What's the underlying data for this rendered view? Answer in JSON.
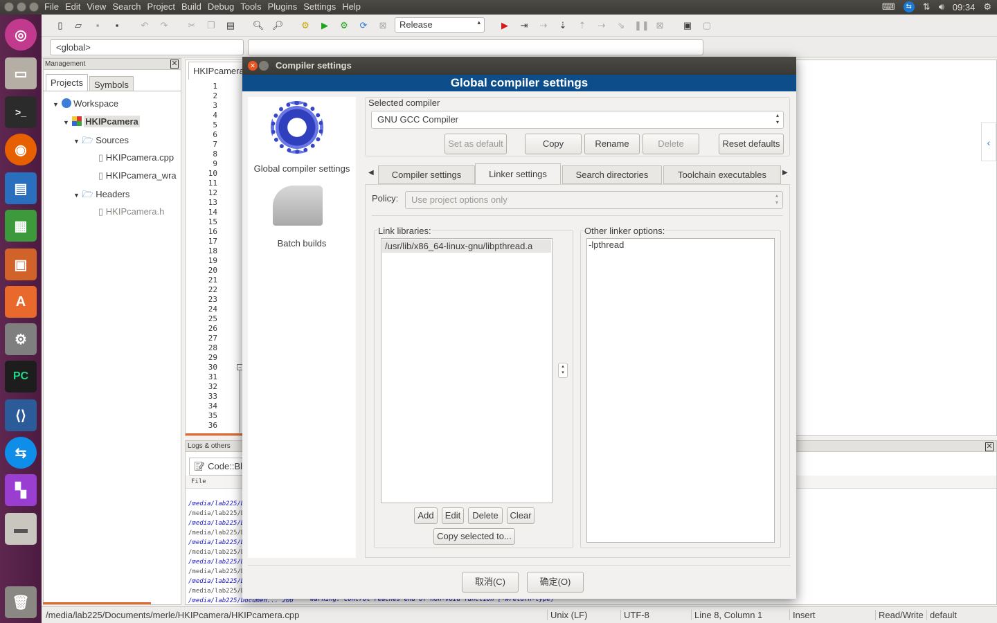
{
  "topbar": {
    "menus": [
      "File",
      "Edit",
      "View",
      "Search",
      "Project",
      "Build",
      "Debug",
      "Tools",
      "Plugins",
      "Settings",
      "Help"
    ],
    "clock": "09:34"
  },
  "toolbar": {
    "build_target": "Release",
    "scope": "<global>"
  },
  "management": {
    "title": "Management",
    "tabs": [
      "Projects",
      "Symbols"
    ],
    "tree": {
      "workspace": "Workspace",
      "project": "HKIPcamera",
      "sources": "Sources",
      "source_files": [
        "HKIPcamera.cpp",
        "HKIPcamera_wra"
      ],
      "headers": "Headers",
      "header_files": [
        "HKIPcamera.h"
      ]
    }
  },
  "editor": {
    "tab": "HKIPcamera",
    "line_numbers": [
      "1",
      "2",
      "3",
      "4",
      "5",
      "6",
      "7",
      "8",
      "9",
      "10",
      "11",
      "12",
      "13",
      "14",
      "15",
      "16",
      "17",
      "18",
      "19",
      "20",
      "21",
      "22",
      "23",
      "24",
      "25",
      "26",
      "27",
      "28",
      "29",
      "30",
      "31",
      "32",
      "33",
      "34",
      "35",
      "36"
    ]
  },
  "logs": {
    "title": "Logs & others",
    "tab": "Code::Bl",
    "column": "File",
    "rows": [
      "/media/lab225/Dc",
      "/media/lab225/Dc",
      "/media/lab225/Dc",
      "/media/lab225/Dc",
      "/media/lab225/Dc",
      "/media/lab225/Dc",
      "/media/lab225/Dc",
      "/media/lab225/Dc",
      "/media/lab225/Dc",
      "/media/lab225/Dc",
      "/media/lab225/Documen...  200"
    ],
    "last_message": "warning: control reaches end of non-void function [-Wreturn-type]"
  },
  "statusbar": {
    "path": "/media/lab225/Documents/merle/HKIPcamera/HKIPcamera.cpp",
    "eol": "Unix (LF)",
    "encoding": "UTF-8",
    "position": "Line 8, Column 1",
    "mode": "Insert",
    "access": "Read/Write",
    "lang": "default"
  },
  "dialog": {
    "title": "Compiler settings",
    "header": "Global compiler settings",
    "left_items": [
      "Global compiler settings",
      "Batch builds"
    ],
    "selected_compiler_label": "Selected compiler",
    "selected_compiler": "GNU GCC Compiler",
    "buttons": {
      "set_default": "Set as default",
      "copy": "Copy",
      "rename": "Rename",
      "delete": "Delete",
      "reset": "Reset defaults"
    },
    "tabs": [
      "Compiler settings",
      "Linker settings",
      "Search directories",
      "Toolchain executables"
    ],
    "active_tab": "Linker settings",
    "policy_label": "Policy:",
    "policy_value": "Use project options only",
    "link_libraries_label": "Link libraries:",
    "link_libraries": [
      "/usr/lib/x86_64-linux-gnu/libpthread.a"
    ],
    "other_linker_label": "Other linker options:",
    "other_linker_options": "-lpthread",
    "lib_buttons": {
      "add": "Add",
      "edit": "Edit",
      "delete": "Delete",
      "clear": "Clear",
      "copy_selected": "Copy selected to..."
    },
    "footer": {
      "cancel": "取消(C)",
      "ok": "确定(O)"
    }
  },
  "colors": {
    "dialog_header": "#0c4d8a",
    "launcher": "#5e2750"
  }
}
